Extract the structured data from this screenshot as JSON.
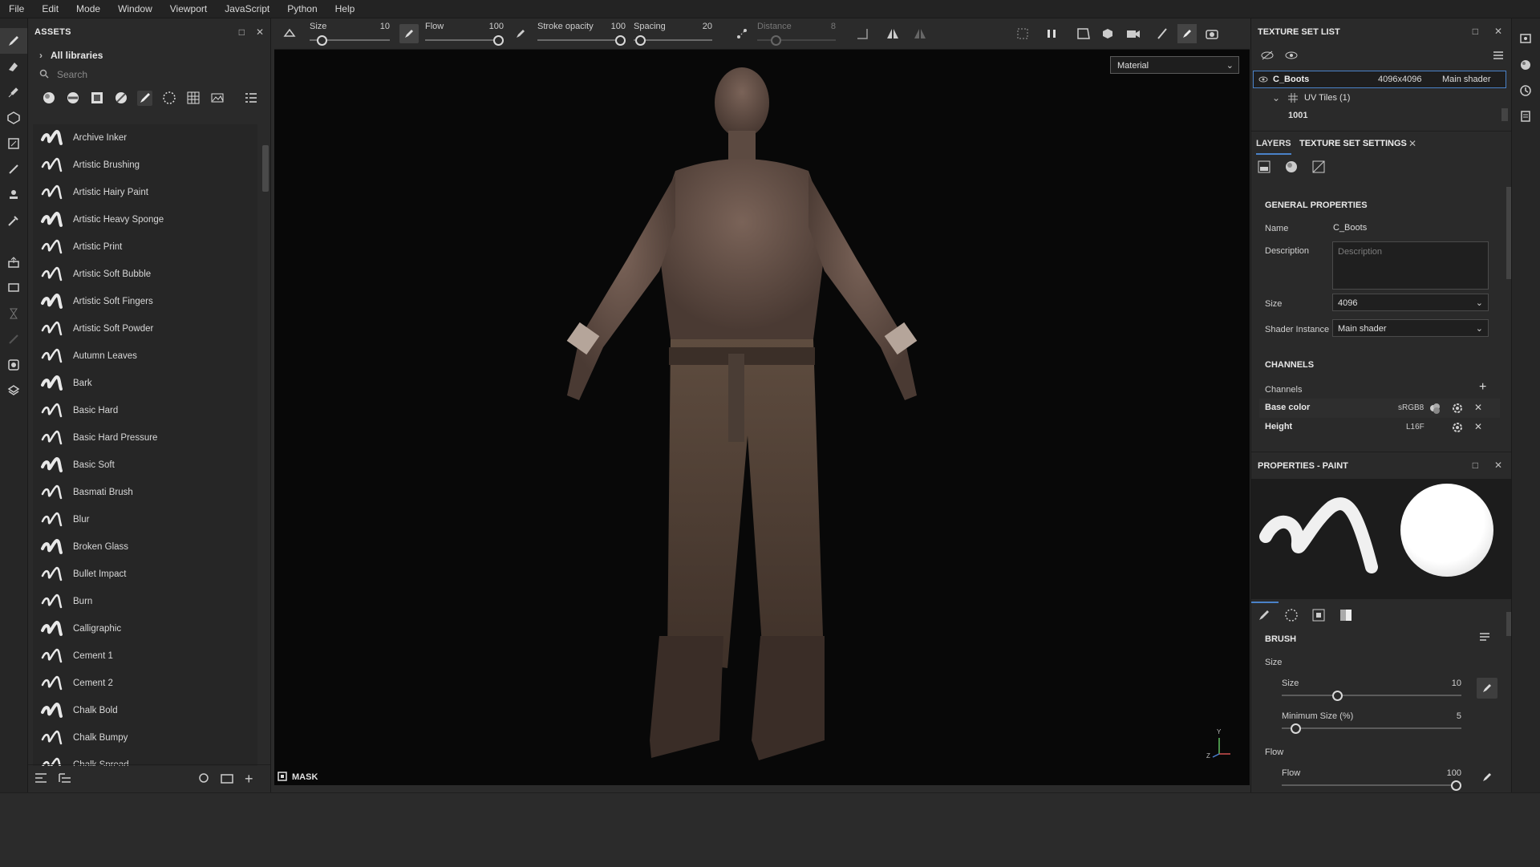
{
  "menu": [
    "File",
    "Edit",
    "Mode",
    "Window",
    "Viewport",
    "JavaScript",
    "Python",
    "Help"
  ],
  "assets": {
    "title": "ASSETS",
    "libraries": "All libraries",
    "search_placeholder": "Search",
    "items": [
      "Archive Inker",
      "Artistic Brushing",
      "Artistic Hairy Paint",
      "Artistic Heavy Sponge",
      "Artistic Print",
      "Artistic Soft Bubble",
      "Artistic Soft Fingers",
      "Artistic Soft Powder",
      "Autumn Leaves",
      "Bark",
      "Basic Hard",
      "Basic Hard Pressure",
      "Basic Soft",
      "Basmati Brush",
      "Blur",
      "Broken Glass",
      "Bullet Impact",
      "Burn",
      "Calligraphic",
      "Cement 1",
      "Cement 2",
      "Chalk Bold",
      "Chalk Bumpy",
      "Chalk Spread"
    ]
  },
  "toolbar": {
    "size": {
      "label": "Size",
      "value": "10",
      "fraction": 0.1
    },
    "flow": {
      "label": "Flow",
      "value": "100",
      "fraction": 1.0
    },
    "stroke_opacity": {
      "label": "Stroke opacity",
      "value": "100",
      "fraction": 1.0
    },
    "spacing": {
      "label": "Spacing",
      "value": "20",
      "fraction": 0.02
    },
    "distance": {
      "label": "Distance",
      "value": "8",
      "fraction": 0.2
    }
  },
  "viewport": {
    "material_mode": "Material",
    "mask_label": "MASK",
    "axis_y": "Y",
    "axis_z": "Z"
  },
  "texture_set_list": {
    "title": "TEXTURE SET LIST",
    "set_name": "C_Boots",
    "resolution": "4096x4096",
    "shader": "Main shader",
    "uv_tiles": "UV Tiles (1)",
    "tile": "1001"
  },
  "tabs": {
    "layers": "LAYERS",
    "tss": "TEXTURE SET SETTINGS"
  },
  "general": {
    "title": "GENERAL PROPERTIES",
    "name_label": "Name",
    "name_value": "C_Boots",
    "description_label": "Description",
    "description_placeholder": "Description",
    "size_label": "Size",
    "size_value": "4096",
    "shader_label": "Shader Instance",
    "shader_value": "Main shader"
  },
  "channels": {
    "title": "CHANNELS",
    "label": "Channels",
    "items": [
      {
        "name": "Base color",
        "format": "sRGB8"
      },
      {
        "name": "Height",
        "format": "L16F"
      }
    ]
  },
  "properties": {
    "title": "PROPERTIES - PAINT",
    "brush_title": "BRUSH",
    "size_group": "Size",
    "size": {
      "label": "Size",
      "value": "10",
      "fraction": 0.3
    },
    "min_size": {
      "label": "Minimum Size (%)",
      "value": "5",
      "fraction": 0.05
    },
    "flow_group": "Flow",
    "flow": {
      "label": "Flow",
      "value": "100",
      "fraction": 1.0
    }
  }
}
